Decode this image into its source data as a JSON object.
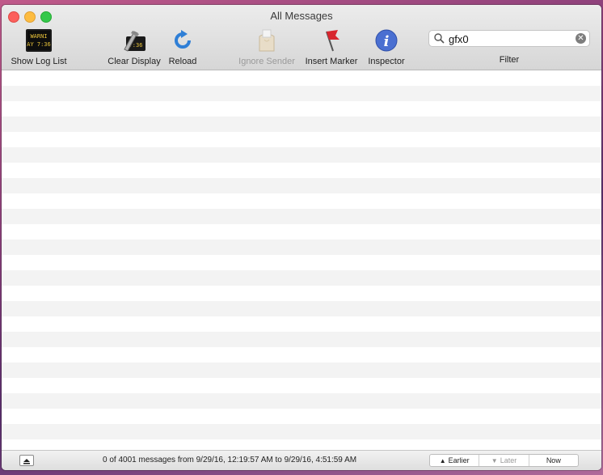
{
  "window": {
    "title": "All Messages"
  },
  "toolbar": {
    "show_log_list": "Show Log List",
    "log_icon_text_top": "WARNI",
    "log_icon_text_bottom": "AY 7:36",
    "clear_display": "Clear Display",
    "reload": "Reload",
    "ignore_sender": "Ignore Sender",
    "insert_marker": "Insert Marker",
    "inspector": "Inspector"
  },
  "search": {
    "value": "gfx0",
    "label": "Filter"
  },
  "status": {
    "message": "0 of 4001 messages from 9/29/16, 12:19:57 AM to 9/29/16, 4:51:59 AM",
    "earlier": "Earlier",
    "later": "Later",
    "now": "Now"
  }
}
